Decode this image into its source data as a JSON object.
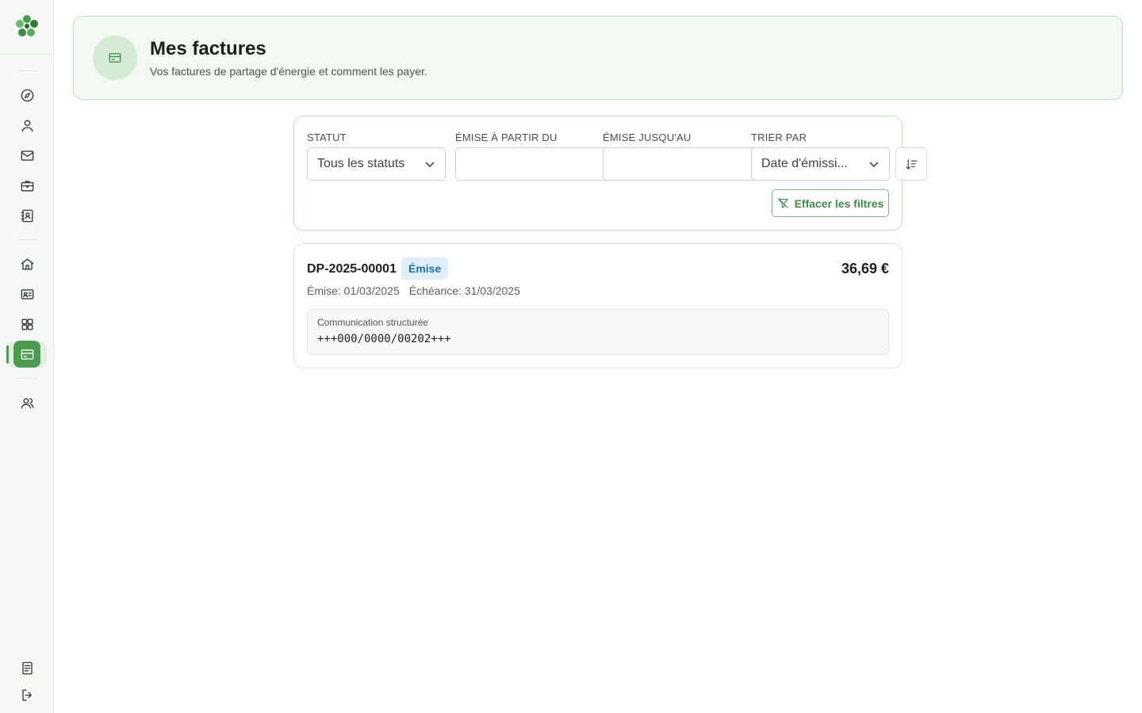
{
  "header": {
    "title": "Mes factures",
    "subtitle": "Vos factures de partage d'énergie et comment les payer.",
    "icon": "credit-card-icon"
  },
  "sidebar": {
    "items": [
      {
        "icon": "compass-icon",
        "active": false
      },
      {
        "icon": "user-icon",
        "active": false
      },
      {
        "icon": "mail-icon",
        "active": false
      },
      {
        "icon": "briefcase-icon",
        "active": false
      },
      {
        "icon": "contact-book-icon",
        "active": false
      },
      {
        "icon": "home-icon",
        "active": false
      },
      {
        "icon": "id-card-icon",
        "active": false
      },
      {
        "icon": "grid-icon",
        "active": false
      },
      {
        "icon": "credit-card-icon",
        "active": true
      },
      {
        "icon": "users-icon",
        "active": false
      },
      {
        "icon": "document-icon",
        "active": false
      },
      {
        "icon": "logout-icon",
        "active": false
      }
    ]
  },
  "filters": {
    "status_label": "STATUT",
    "status_value": "Tous les statuts",
    "from_label": "ÉMISE À PARTIR DU",
    "from_value": "",
    "to_label": "ÉMISE JUSQU'AU",
    "to_value": "",
    "sort_label": "TRIER PAR",
    "sort_value": "Date d'émissi...",
    "clear_label": "Effacer les filtres"
  },
  "invoices": [
    {
      "number": "DP-2025-00001",
      "status": "Émise",
      "amount": "36,69 €",
      "issued": "Émise: 01/03/2025",
      "due": "Échéance: 31/03/2025",
      "communication_label": "Communication structurée",
      "communication_value": "+++000/0000/00202+++"
    }
  ],
  "colors": {
    "brand": "#4a9a4f",
    "header_bg": "#f2f9f2",
    "badge_bg": "#e0eff8",
    "badge_text": "#1f6fa0"
  }
}
